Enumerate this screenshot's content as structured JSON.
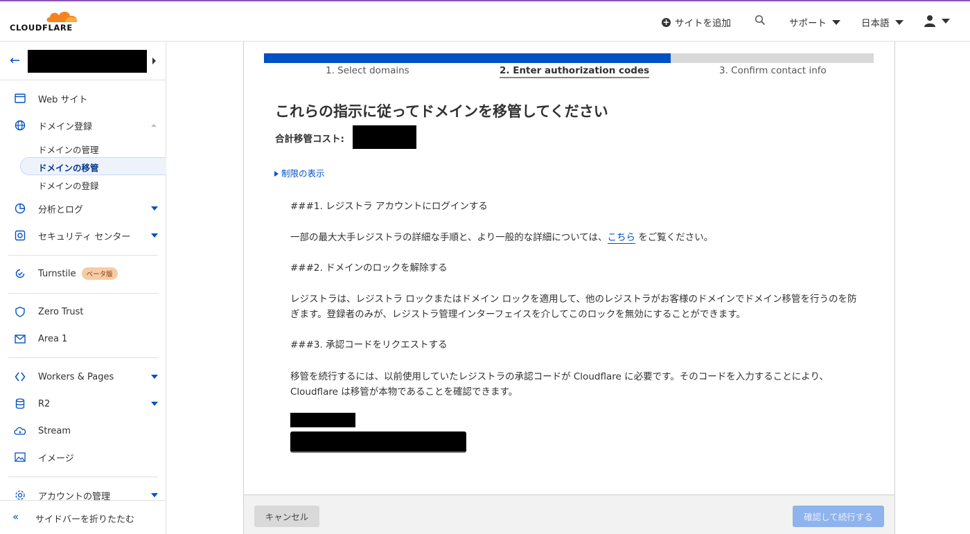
{
  "colors": {
    "accent": "#0051c3",
    "brand_orange": "#f6821f",
    "top_strip": "#8b52b8"
  },
  "header": {
    "logo_text": "CLOUDFLARE",
    "add_site": "サイトを追加",
    "support": "サポート",
    "language": "日本語",
    "icons": [
      "plus-circle-icon",
      "search-icon",
      "user-icon"
    ]
  },
  "sidebar": {
    "items": [
      {
        "label": "Web サイト",
        "icon": "browser-icon"
      },
      {
        "label": "ドメイン登録",
        "icon": "globe-icon"
      },
      {
        "label": "分析とログ",
        "icon": "chart-pie-icon"
      },
      {
        "label": "セキュリティ センター",
        "icon": "security-center-icon"
      },
      {
        "label": "Turnstile",
        "icon": "turnstile-icon",
        "badge": "ベータ版"
      },
      {
        "label": "Zero Trust",
        "icon": "shield-icon"
      },
      {
        "label": "Area 1",
        "icon": "mail-icon"
      },
      {
        "label": "Workers & Pages",
        "icon": "workers-icon"
      },
      {
        "label": "R2",
        "icon": "database-icon"
      },
      {
        "label": "Stream",
        "icon": "cloud-play-icon"
      },
      {
        "label": "イメージ",
        "icon": "image-icon"
      },
      {
        "label": "アカウントの管理",
        "icon": "gear-icon"
      }
    ],
    "domain_sub": [
      "ドメインの管理",
      "ドメインの移管",
      "ドメインの登録"
    ],
    "collapse_label": "サイドバーを折りたたむ"
  },
  "wizard": {
    "progress_fraction": 0.667,
    "steps": [
      "1. Select domains",
      "2. Enter authorization codes",
      "3. Confirm contact info"
    ],
    "active_step": 2
  },
  "content": {
    "title": "これらの指示に従ってドメインを移管してください",
    "cost_label": "合計移管コスト:",
    "limits_link": "制限の表示",
    "h1": "###1.  レジストラ アカウントにログインする",
    "p1_before": "一部の最大大手レジストラの詳細な手順と、より一般的な詳細については、",
    "p1_link": "こちら",
    "p1_after": " をご覧ください。",
    "h2": "###2.  ドメインのロックを解除する",
    "p2": "レジストラは、レジストラ ロックまたはドメイン ロックを適用して、他のレジストラがお客様のドメインでドメイン移管を行うのを防ぎます。登録者のみが、レジストラ管理インターフェイスを介してこのロックを無効にすることができます。",
    "h3": "###3.  承認コードをリクエストする",
    "p3": "移管を続行するには、以前使用していたレジストラの承認コードが Cloudflare に必要です。そのコードを入力することにより、Cloudflare は移管が本物であることを確認できます。"
  },
  "footer": {
    "cancel": "キャンセル",
    "confirm": "確認して続行する"
  }
}
